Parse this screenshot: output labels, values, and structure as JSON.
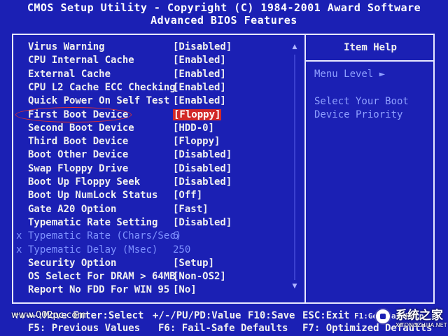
{
  "header": {
    "title": "CMOS Setup Utility - Copyright (C) 1984-2001 Award Software",
    "subtitle": "Advanced BIOS Features"
  },
  "settings": [
    {
      "label": "Virus Warning",
      "value": "[Disabled]",
      "enabled": true
    },
    {
      "label": "CPU Internal Cache",
      "value": "[Enabled]",
      "enabled": true
    },
    {
      "label": "External Cache",
      "value": "[Enabled]",
      "enabled": true
    },
    {
      "label": "CPU L2 Cache ECC Checking",
      "value": "[Enabled]",
      "enabled": true
    },
    {
      "label": "Quick Power On Self Test",
      "value": "[Enabled]",
      "enabled": true
    },
    {
      "label": "First Boot Device",
      "value": "[Floppy]",
      "enabled": true,
      "selected": true
    },
    {
      "label": "Second Boot Device",
      "value": "[HDD-0]",
      "enabled": true
    },
    {
      "label": "Third Boot Device",
      "value": "[Floppy]",
      "enabled": true
    },
    {
      "label": "Boot Other Device",
      "value": "[Disabled]",
      "enabled": true
    },
    {
      "label": "Swap Floppy Drive",
      "value": "[Disabled]",
      "enabled": true
    },
    {
      "label": "Boot Up Floppy Seek",
      "value": "[Disabled]",
      "enabled": true
    },
    {
      "label": "Boot Up NumLock Status",
      "value": "[Off]",
      "enabled": true
    },
    {
      "label": "Gate A20 Option",
      "value": "[Fast]",
      "enabled": true
    },
    {
      "label": "Typematic Rate Setting",
      "value": "[Disabled]",
      "enabled": true
    },
    {
      "label": "Typematic Rate (Chars/Sec)",
      "value": "6",
      "enabled": false,
      "mark": "x"
    },
    {
      "label": "Typematic Delay (Msec)",
      "value": "250",
      "enabled": false,
      "mark": "x"
    },
    {
      "label": "Security Option",
      "value": "[Setup]",
      "enabled": true
    },
    {
      "label": "OS Select For DRAM > 64MB",
      "value": "[Non-OS2]",
      "enabled": true
    },
    {
      "label": "Report No FDD For WIN 95",
      "value": "[No]",
      "enabled": true
    }
  ],
  "help": {
    "title": "Item Help",
    "menu_level": "Menu Level  ►",
    "line1": "Select Your Boot",
    "line2": "Device Priority"
  },
  "footer": {
    "row1": [
      {
        "text": "↑↓→←:Move  Enter:Select"
      },
      {
        "text": "+/-/PU/PD:Value"
      },
      {
        "text": "F10:Save"
      },
      {
        "text": "ESC:Exit"
      },
      {
        "text": "F1:General Help"
      }
    ],
    "row2": [
      {
        "text": "F5: Previous Values"
      },
      {
        "text": "F6: Fail-Safe Defaults"
      },
      {
        "text": "F7: Optimized Defaults"
      }
    ]
  },
  "watermarks": {
    "left": "www.002pc.com",
    "right_big": "系统之家",
    "right_small": "XITONGZHIJIA.NET",
    "mid": "zhidao.baidu.com"
  },
  "colors": {
    "background": "#1b20b4",
    "highlight": "#d22828",
    "disabled_text": "#7f92ff"
  }
}
